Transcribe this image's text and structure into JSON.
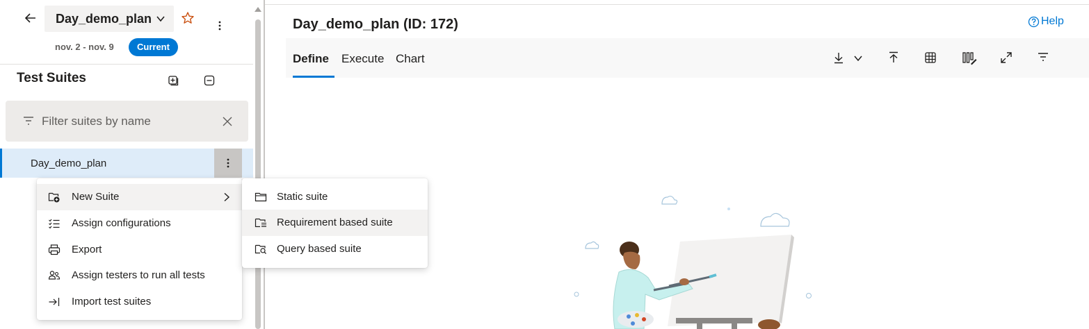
{
  "header": {
    "plan_name": "Day_demo_plan",
    "date_range": "nov. 2 - nov. 9",
    "badge": "Current"
  },
  "suites_panel": {
    "title": "Test Suites",
    "filter_placeholder": "Filter suites by name",
    "tree": [
      {
        "label": "Day_demo_plan",
        "selected": true
      }
    ]
  },
  "main": {
    "title": "Day_demo_plan (ID: 172)",
    "help_label": "Help",
    "tabs": [
      {
        "label": "Define",
        "active": true
      },
      {
        "label": "Execute",
        "active": false
      },
      {
        "label": "Chart",
        "active": false
      }
    ],
    "toolbar_icons": [
      "download-icon",
      "chevron-down-icon",
      "upload-icon",
      "grid-icon",
      "column-options-icon",
      "fullscreen-icon",
      "filter-icon"
    ]
  },
  "context_menu": {
    "items": [
      {
        "label": "New Suite",
        "icon": "new-suite-icon",
        "has_submenu": true,
        "highlighted": true
      },
      {
        "label": "Assign configurations",
        "icon": "checklist-icon"
      },
      {
        "label": "Export",
        "icon": "print-icon"
      },
      {
        "label": "Assign testers to run all tests",
        "icon": "people-icon"
      },
      {
        "label": "Import test suites",
        "icon": "import-icon"
      }
    ]
  },
  "submenu": {
    "items": [
      {
        "label": "Static suite",
        "icon": "folder-icon"
      },
      {
        "label": "Requirement based suite",
        "icon": "requirement-folder-icon",
        "highlighted": true
      },
      {
        "label": "Query based suite",
        "icon": "query-folder-icon"
      }
    ]
  },
  "colors": {
    "accent": "#0078d4",
    "selected_row": "#deecf9",
    "star": "#ca5010"
  }
}
